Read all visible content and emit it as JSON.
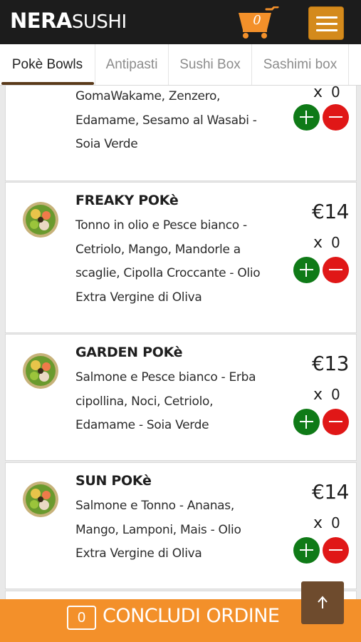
{
  "header": {
    "logo_bold": "NERA",
    "logo_light": "SUSHI",
    "cart_count": "0"
  },
  "tabs": [
    {
      "label": "Pokè Bowls",
      "active": true
    },
    {
      "label": "Antipasti"
    },
    {
      "label": "Sushi Box"
    },
    {
      "label": "Sashimi box"
    }
  ],
  "items": [
    {
      "name": "",
      "description": "GomaWakame, Zenzero, Edamame, Sesamo al Wasabi - Soia Verde",
      "price": "",
      "qty_x": "x",
      "qty": "0"
    },
    {
      "name": "FREAKY POKè",
      "description": "Tonno in olio e Pesce bianco - Cetriolo, Mango, Mandorle a scaglie, Cipolla Croccante - Olio Extra Vergine di Oliva",
      "price": "€14",
      "qty_x": "x",
      "qty": "0"
    },
    {
      "name": "GARDEN POKè",
      "description": "Salmone e Pesce bianco - Erba cipollina, Noci, Cetriolo, Edamame - Soia Verde",
      "price": "€13",
      "qty_x": "x",
      "qty": "0"
    },
    {
      "name": "SUN POKè",
      "description": "Salmone e Tonno - Ananas, Mango, Lamponi, Mais - Olio Extra Vergine di Oliva",
      "price": "€14",
      "qty_x": "x",
      "qty": "0"
    }
  ],
  "footer": {
    "order_count": "0",
    "conclude_label": "CONCLUDI ORDINE"
  },
  "icons": {
    "cart": "shopping-cart-icon",
    "menu": "hamburger-menu-icon",
    "plus": "plus-icon",
    "minus": "minus-icon",
    "up": "arrow-up-icon"
  },
  "colors": {
    "header_bg": "#1c1c1c",
    "accent_orange": "#f3902a",
    "menu_button": "#d48a1c",
    "add_green": "#0f7a17",
    "remove_red": "#e01717",
    "scroll_top_brown": "#6e4b2d"
  }
}
